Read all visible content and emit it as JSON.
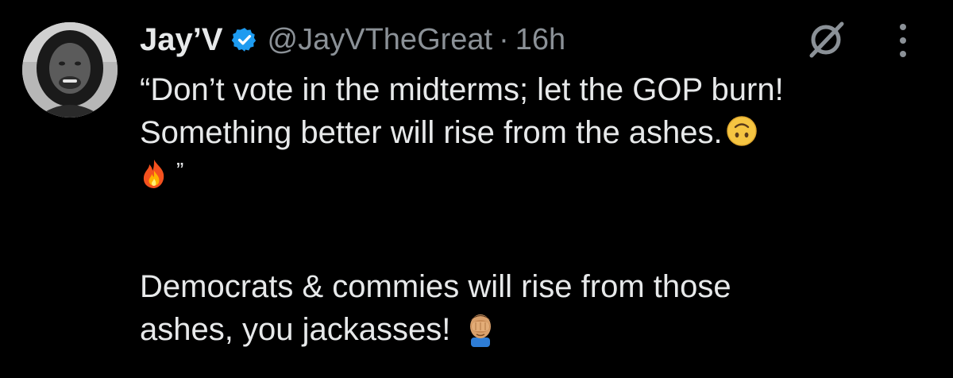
{
  "author": {
    "display_name": "Jay’V",
    "handle": "@JayVTheGreat",
    "separator": "·",
    "time": "16h",
    "verified": true,
    "verified_color": "#1d9bf0"
  },
  "post": {
    "line1": "“Don’t vote in the midterms; let the GOP burn!",
    "line2": "Something better will rise from the ashes.",
    "line3_quote_close": "”",
    "line4": "Democrats & commies will rise from those",
    "line5": "ashes, you jackasses!",
    "emojis": [
      "upside-down-face-emoji",
      "fire-emoji",
      "face-palm-emoji"
    ]
  },
  "icons": [
    "grok-icon",
    "more-options-icon",
    "verified-badge-icon"
  ],
  "colors": {
    "background": "#000000",
    "text": "#e7e9ea",
    "secondary_text": "#8b9197"
  }
}
